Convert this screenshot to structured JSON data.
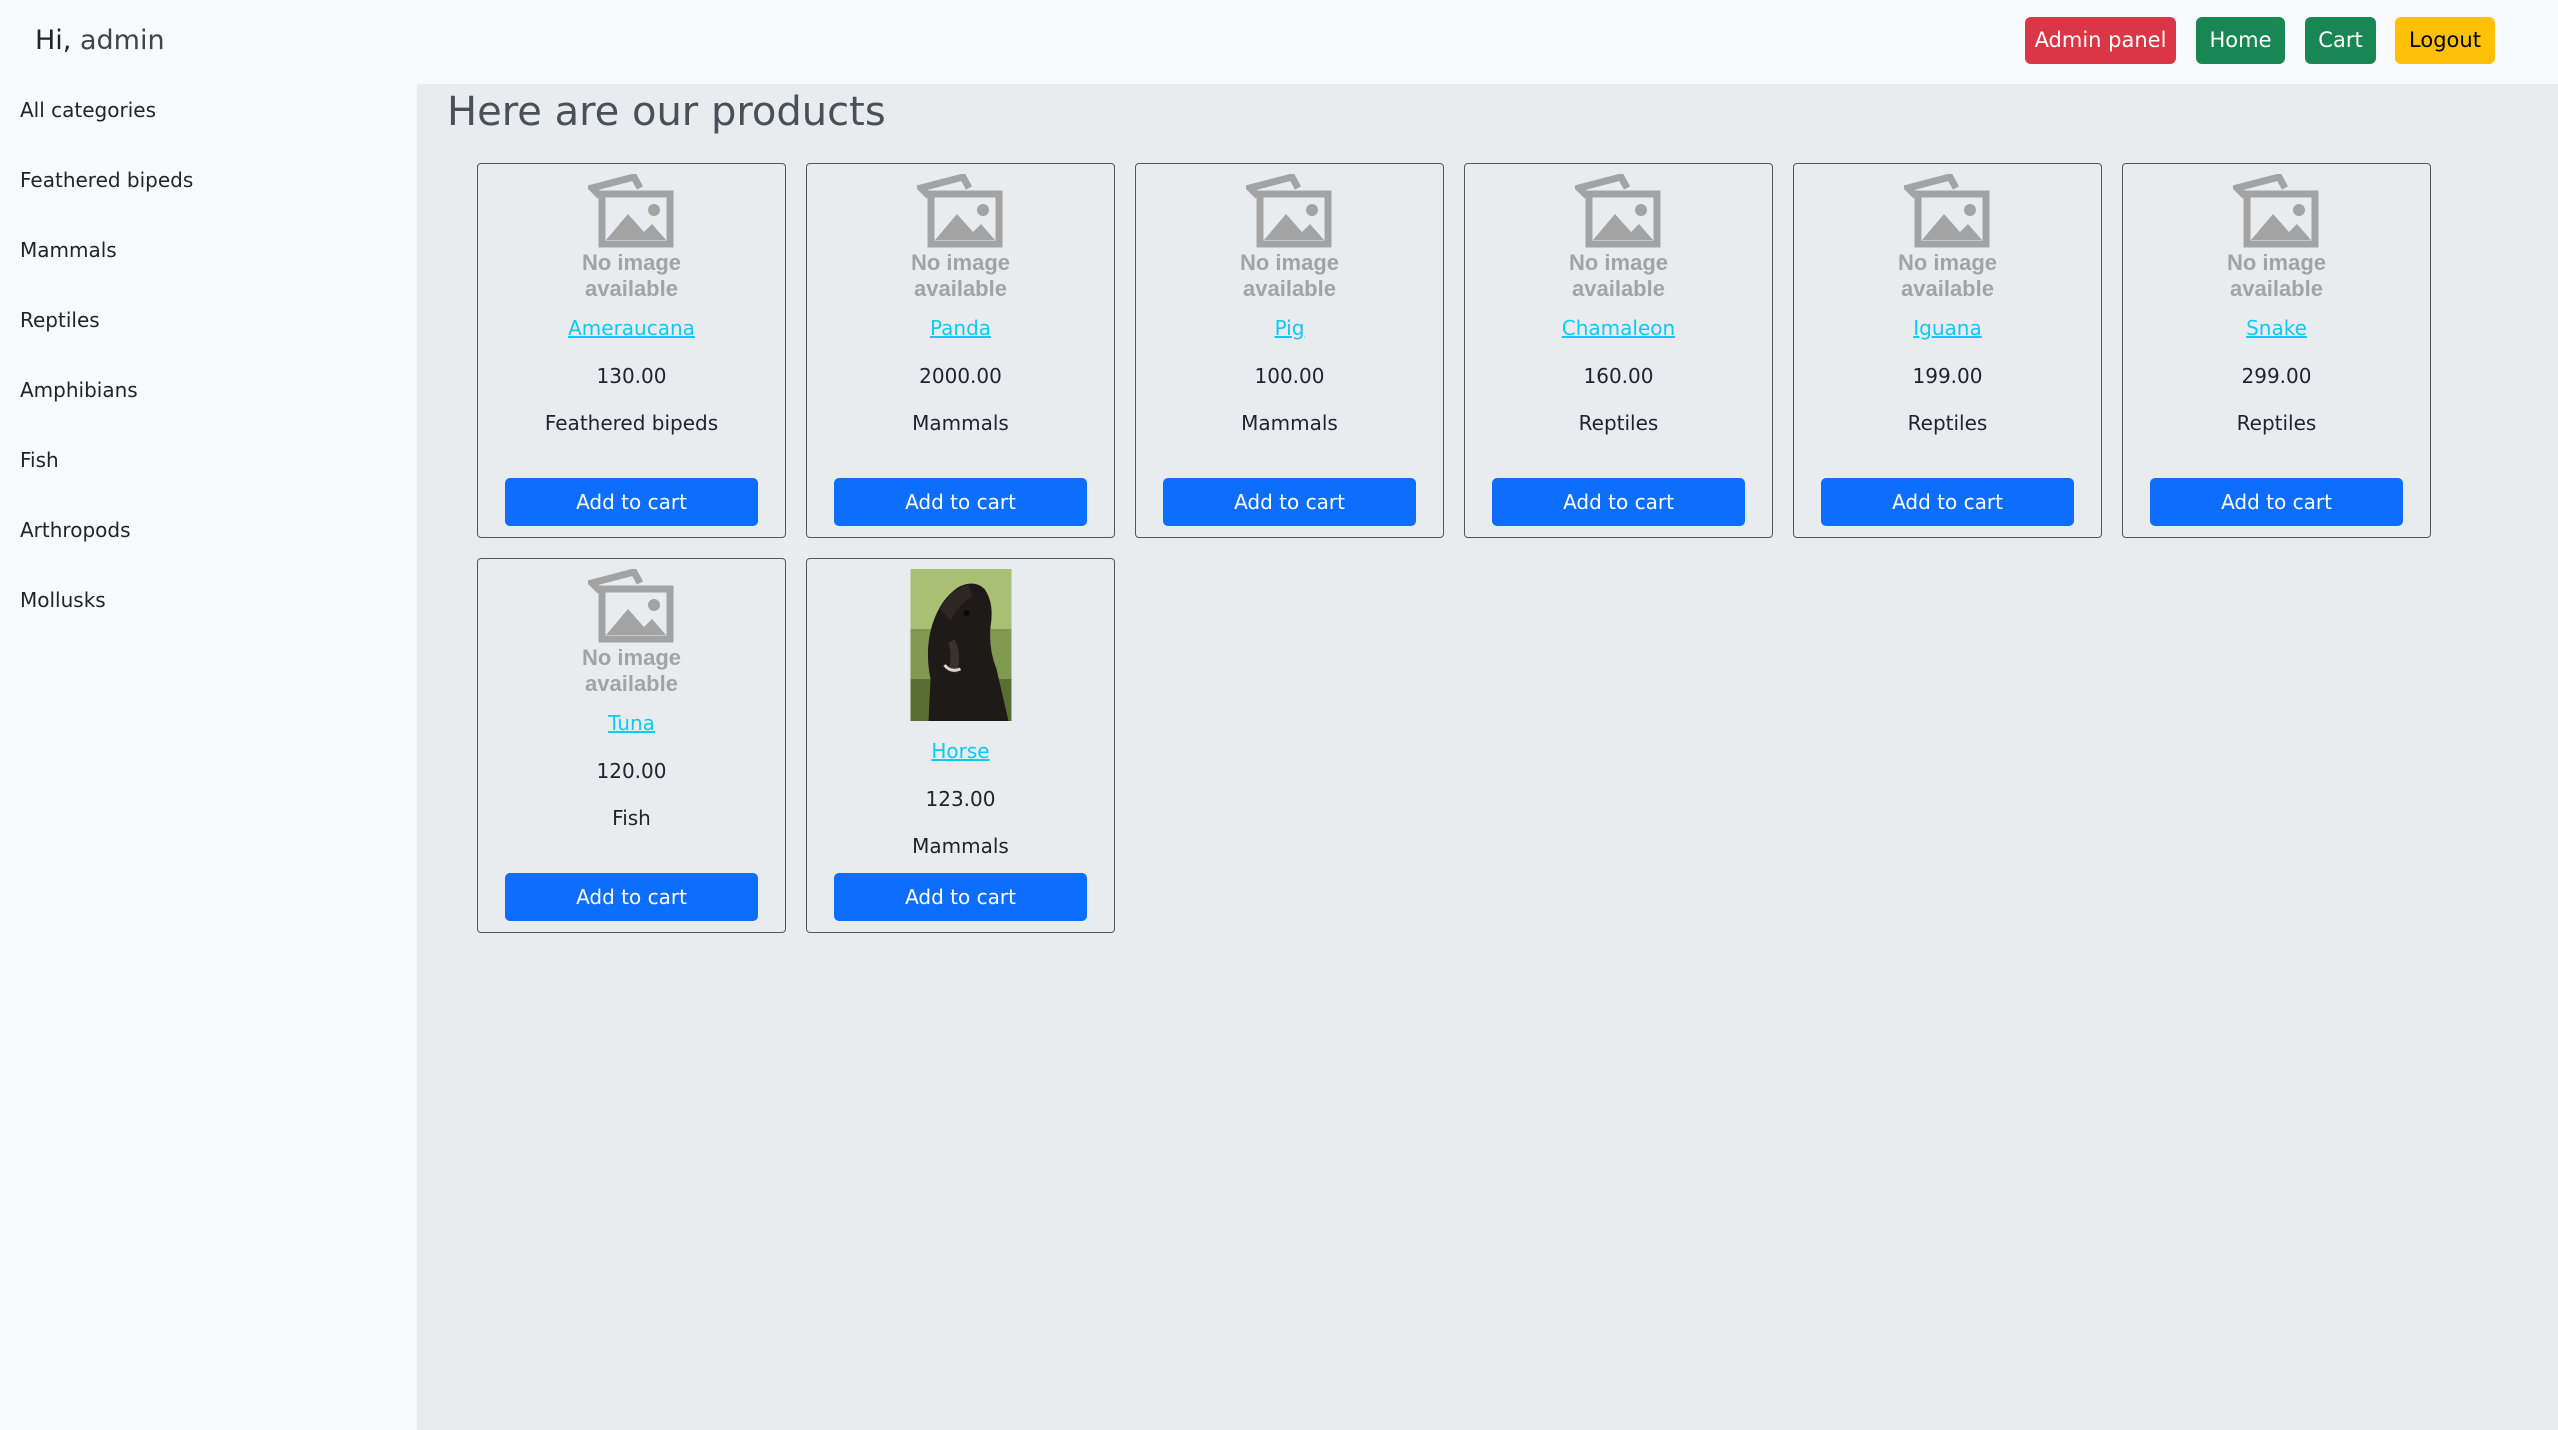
{
  "header": {
    "greeting_prefix": "Hi,",
    "username": "admin",
    "buttons": {
      "admin_panel": "Admin panel",
      "home": "Home",
      "cart": "Cart",
      "logout": "Logout"
    }
  },
  "sidebar": {
    "items": [
      {
        "label": "All categories"
      },
      {
        "label": "Feathered bipeds"
      },
      {
        "label": "Mammals"
      },
      {
        "label": "Reptiles"
      },
      {
        "label": "Amphibians"
      },
      {
        "label": "Fish"
      },
      {
        "label": "Arthropods"
      },
      {
        "label": "Mollusks"
      }
    ]
  },
  "main": {
    "title": "Here are our products",
    "no_image_text": {
      "line1": "No image",
      "line2": "available"
    },
    "add_to_cart_label": "Add to cart",
    "products": [
      {
        "name": "Ameraucana",
        "price": "130.00",
        "category": "Feathered bipeds",
        "image": "no-image-placeholder"
      },
      {
        "name": "Panda",
        "price": "2000.00",
        "category": "Mammals",
        "image": "no-image-placeholder"
      },
      {
        "name": "Pig",
        "price": "100.00",
        "category": "Mammals",
        "image": "no-image-placeholder"
      },
      {
        "name": "Chamaleon",
        "price": "160.00",
        "category": "Reptiles",
        "image": "no-image-placeholder"
      },
      {
        "name": "Iguana",
        "price": "199.00",
        "category": "Reptiles",
        "image": "no-image-placeholder"
      },
      {
        "name": "Snake",
        "price": "299.00",
        "category": "Reptiles",
        "image": "no-image-placeholder"
      },
      {
        "name": "Tuna",
        "price": "120.00",
        "category": "Fish",
        "image": "no-image-placeholder"
      },
      {
        "name": "Horse",
        "price": "123.00",
        "category": "Mammals",
        "image": "horse-photo"
      }
    ]
  },
  "colors": {
    "danger": "#dc3545",
    "success": "#198754",
    "warning": "#ffc107",
    "primary": "#0d6efd",
    "link": "#0dcaf0"
  }
}
